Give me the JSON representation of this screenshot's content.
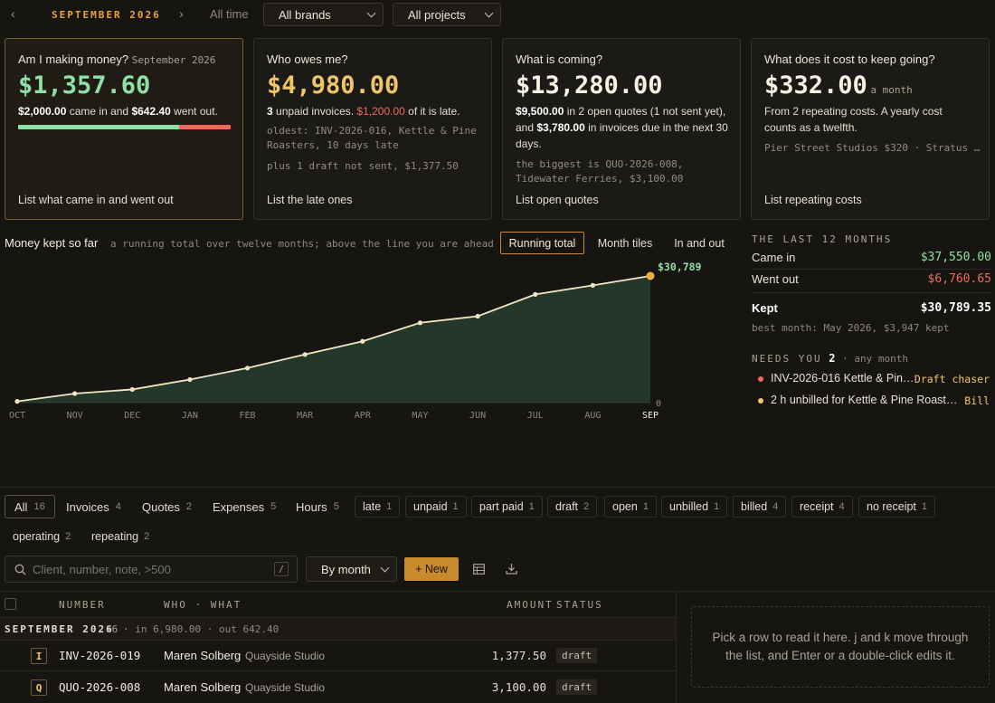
{
  "topbar": {
    "month": "SEPTEMBER 2026",
    "all_time": "All time",
    "brand_select": "All brands",
    "project_select": "All projects"
  },
  "cards": [
    {
      "question": "Am I making money?",
      "question_sub": "September 2026",
      "value": "$1,357.60",
      "desc_a": "$2,000.00",
      "desc_b": " came in and ",
      "desc_c": "$642.40",
      "desc_d": " went out.",
      "in_share": 0.757,
      "link": "List what came in and went out"
    },
    {
      "question": "Who owes me?",
      "value": "$4,980.00",
      "desc_a": "3",
      "desc_b": " unpaid invoices. ",
      "desc_c": "$1,200.00",
      "desc_d": " of it is late.",
      "note1": "oldest: INV-2026-016, Kettle & Pine Roasters, 10 days late",
      "note2": "plus 1 draft not sent, $1,377.50",
      "link": "List the late ones"
    },
    {
      "question": "What is coming?",
      "value": "$13,280.00",
      "desc_a": "$9,500.00",
      "desc_b": " in 2 open quotes (1 not sent yet), and ",
      "desc_c": "$3,780.00",
      "desc_d": " in invoices due in the next 30 days.",
      "note1": "the biggest is QUO-2026-008, Tidewater Ferries, $3,100.00",
      "link": "List open quotes"
    },
    {
      "question": "What does it cost to keep going?",
      "value": "$332.00",
      "value_sub": "a month",
      "desc": "From 2 repeating costs. A yearly cost counts as a twelfth.",
      "note1": "Pier Street Studios $320 · Stratus …",
      "link": "List repeating costs"
    }
  ],
  "chart_header": {
    "title": "Money kept so far",
    "subtitle": "a running total over twelve months; above the line you are ahead",
    "tabs": [
      "Running total",
      "Month tiles",
      "In and out"
    ]
  },
  "chart_data": {
    "type": "area",
    "categories": [
      "OCT",
      "NOV",
      "DEC",
      "JAN",
      "FEB",
      "MAR",
      "APR",
      "MAY",
      "JUN",
      "JUL",
      "AUG",
      "SEP"
    ],
    "values": [
      300,
      2200,
      3200,
      5600,
      8400,
      11700,
      14900,
      19400,
      21000,
      26300,
      28500,
      30789
    ],
    "end_label": "$30,789",
    "zero_label": "0",
    "ylim": [
      0,
      30789
    ]
  },
  "summary": {
    "caption": "THE LAST 12 MONTHS",
    "came_in_label": "Came in",
    "came_in_value": "$37,550.00",
    "went_out_label": "Went out",
    "went_out_value": "$6,760.65",
    "kept_label": "Kept",
    "kept_value": "$30,789.35",
    "best": "best month: May 2026, $3,947 kept",
    "needs_caption": "NEEDS YOU",
    "needs_count": "2",
    "needs_scope": "· any month",
    "needs": [
      {
        "text": "INV-2026-016 Kettle & Pin…",
        "action": "Draft chaser",
        "color": "#ef6a5a"
      },
      {
        "text": "2 h unbilled for Kettle & Pine Roast…",
        "action": "Bill",
        "color": "#f0c56a"
      }
    ]
  },
  "tabs": [
    {
      "label": "All",
      "count": "16"
    },
    {
      "label": "Invoices",
      "count": "4"
    },
    {
      "label": "Quotes",
      "count": "2"
    },
    {
      "label": "Expenses",
      "count": "5"
    },
    {
      "label": "Hours",
      "count": "5"
    }
  ],
  "chips": [
    {
      "label": "late",
      "count": "1"
    },
    {
      "label": "unpaid",
      "count": "1"
    },
    {
      "label": "part paid",
      "count": "1"
    },
    {
      "label": "draft",
      "count": "2"
    },
    {
      "label": "open",
      "count": "1"
    },
    {
      "label": "unbilled",
      "count": "1"
    },
    {
      "label": "billed",
      "count": "4"
    },
    {
      "label": "receipt",
      "count": "4"
    },
    {
      "label": "no receipt",
      "count": "1"
    },
    {
      "label": "operating",
      "count": "2"
    },
    {
      "label": "repeating",
      "count": "2"
    }
  ],
  "toolbar": {
    "search_placeholder": "Client, number, note, >500",
    "slash": "/",
    "group_select": "By month",
    "new_label": "+ New"
  },
  "table": {
    "headers": {
      "number": "NUMBER",
      "who": "WHO · WHAT",
      "amount": "AMOUNT",
      "status": "STATUS"
    },
    "group": {
      "title": "SEPTEMBER 2026",
      "count": "16",
      "detail": "· in 6,980.00 · out 642.40"
    },
    "rows": [
      {
        "kind": "I",
        "number": "INV-2026-019",
        "who": "Maren Solberg",
        "what": "Quayside Studio",
        "amount": "1,377.50",
        "status": "draft"
      },
      {
        "kind": "Q",
        "number": "QUO-2026-008",
        "who": "Maren Solberg",
        "what": "Quayside Studio",
        "amount": "3,100.00",
        "status": "draft"
      }
    ]
  },
  "detail_hint": "Pick a row to read it here. j and k move through the list, and Enter or a double-click edits it."
}
